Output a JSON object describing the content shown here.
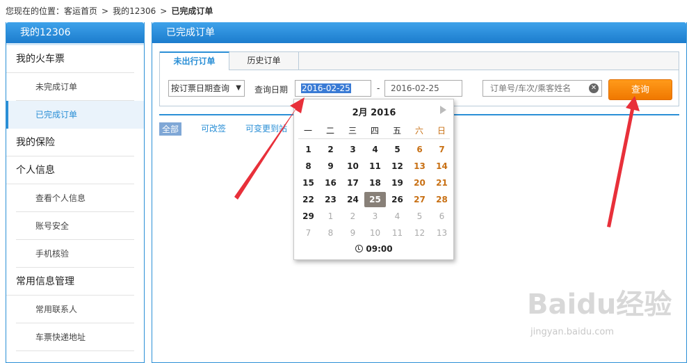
{
  "breadcrumb": {
    "prefix": "您现在的位置：",
    "home": "客运首页",
    "sep": ">",
    "level2": "我的12306",
    "current": "已完成订单"
  },
  "sidebar": {
    "title": "我的12306",
    "sections": [
      {
        "label": "我的火车票",
        "items": [
          "未完成订单",
          "已完成订单"
        ]
      },
      {
        "label": "我的保险",
        "items": []
      },
      {
        "label": "个人信息",
        "items": [
          "查看个人信息",
          "账号安全",
          "手机核验"
        ]
      },
      {
        "label": "常用信息管理",
        "items": [
          "常用联系人",
          "车票快递地址"
        ]
      }
    ],
    "active_item": "已完成订单"
  },
  "main": {
    "title": "已完成订单",
    "tabs": [
      "未出行订单",
      "历史订单"
    ],
    "active_tab": "未出行订单",
    "query_type": "按订票日期查询",
    "date_label": "查询日期",
    "date_from": "2016-02-25",
    "date_dash": "-",
    "date_to": "2016-02-25",
    "order_placeholder": "订单号/车次/乘客姓名",
    "query_button": "查询",
    "filters": [
      "全部",
      "可改签",
      "可变更到站"
    ]
  },
  "calendar": {
    "title": "2月 2016",
    "weekdays": [
      "一",
      "二",
      "三",
      "四",
      "五",
      "六",
      "日"
    ],
    "weeks": [
      [
        "1",
        "2",
        "3",
        "4",
        "5",
        "6",
        "7"
      ],
      [
        "8",
        "9",
        "10",
        "11",
        "12",
        "13",
        "14"
      ],
      [
        "15",
        "16",
        "17",
        "18",
        "19",
        "20",
        "21"
      ],
      [
        "22",
        "23",
        "24",
        "25",
        "26",
        "27",
        "28"
      ],
      [
        "29",
        "1",
        "2",
        "3",
        "4",
        "5",
        "6"
      ],
      [
        "7",
        "8",
        "9",
        "10",
        "11",
        "12",
        "13"
      ]
    ],
    "selected": "25",
    "time": "09:00",
    "colors": {
      "weekend": "#c87014",
      "selected_bg": "#888078",
      "other_month": "#aaaaaa"
    }
  },
  "watermark": {
    "main": "Baidu经验",
    "sub": "jingyan.baidu.com"
  },
  "colors": {
    "brand_blue": "#2a8fd6",
    "query_orange": "#f58a0b",
    "arrow_red": "#e8303a"
  }
}
